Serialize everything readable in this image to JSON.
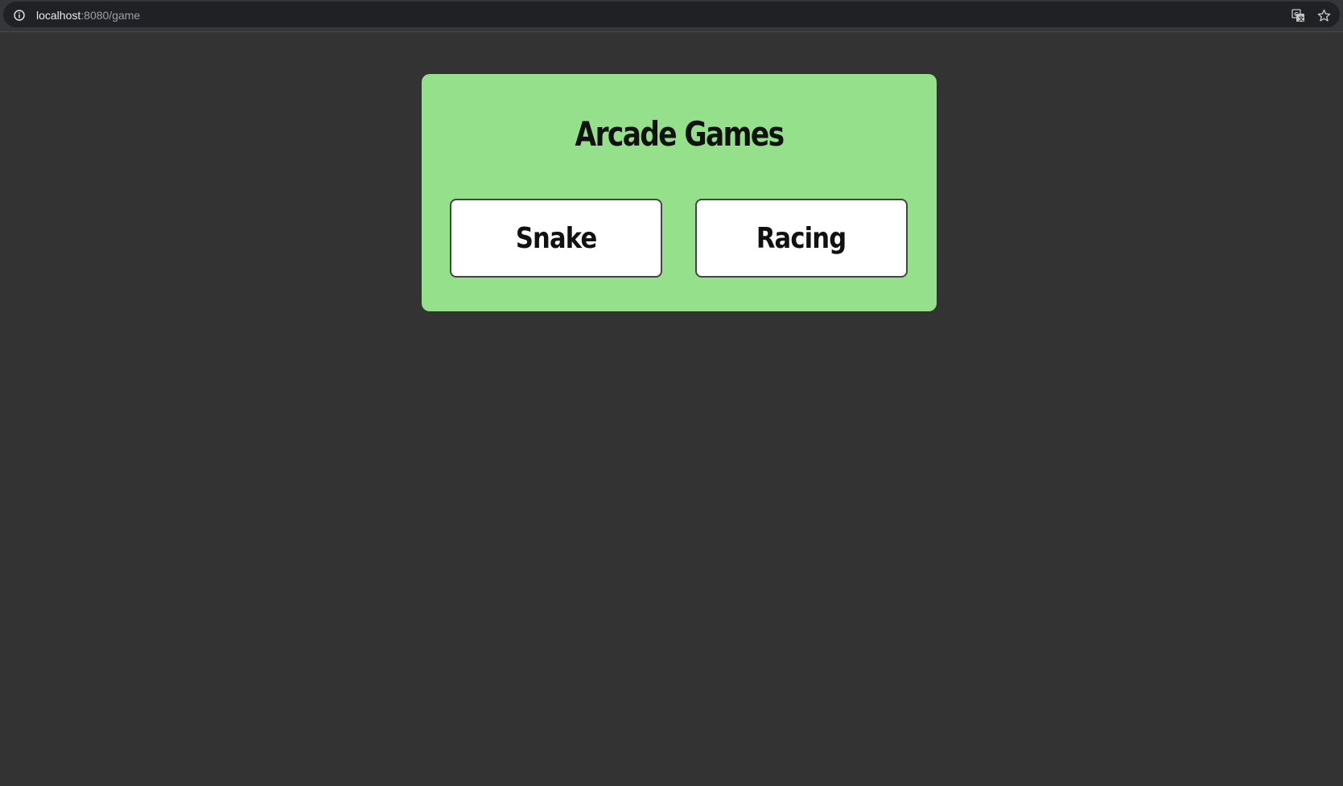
{
  "browser": {
    "url_host": "localhost",
    "url_rest": ":8080/game"
  },
  "icons": {
    "info": "info-icon",
    "translate": "translate-icon",
    "bookmark": "star-icon"
  },
  "colors": {
    "page_background": "#333333",
    "card_background": "#95e08a",
    "button_background": "#ffffff",
    "text": "#111111"
  },
  "card": {
    "title": "Arcade Games",
    "games": [
      {
        "label": "Snake"
      },
      {
        "label": "Racing"
      }
    ]
  }
}
